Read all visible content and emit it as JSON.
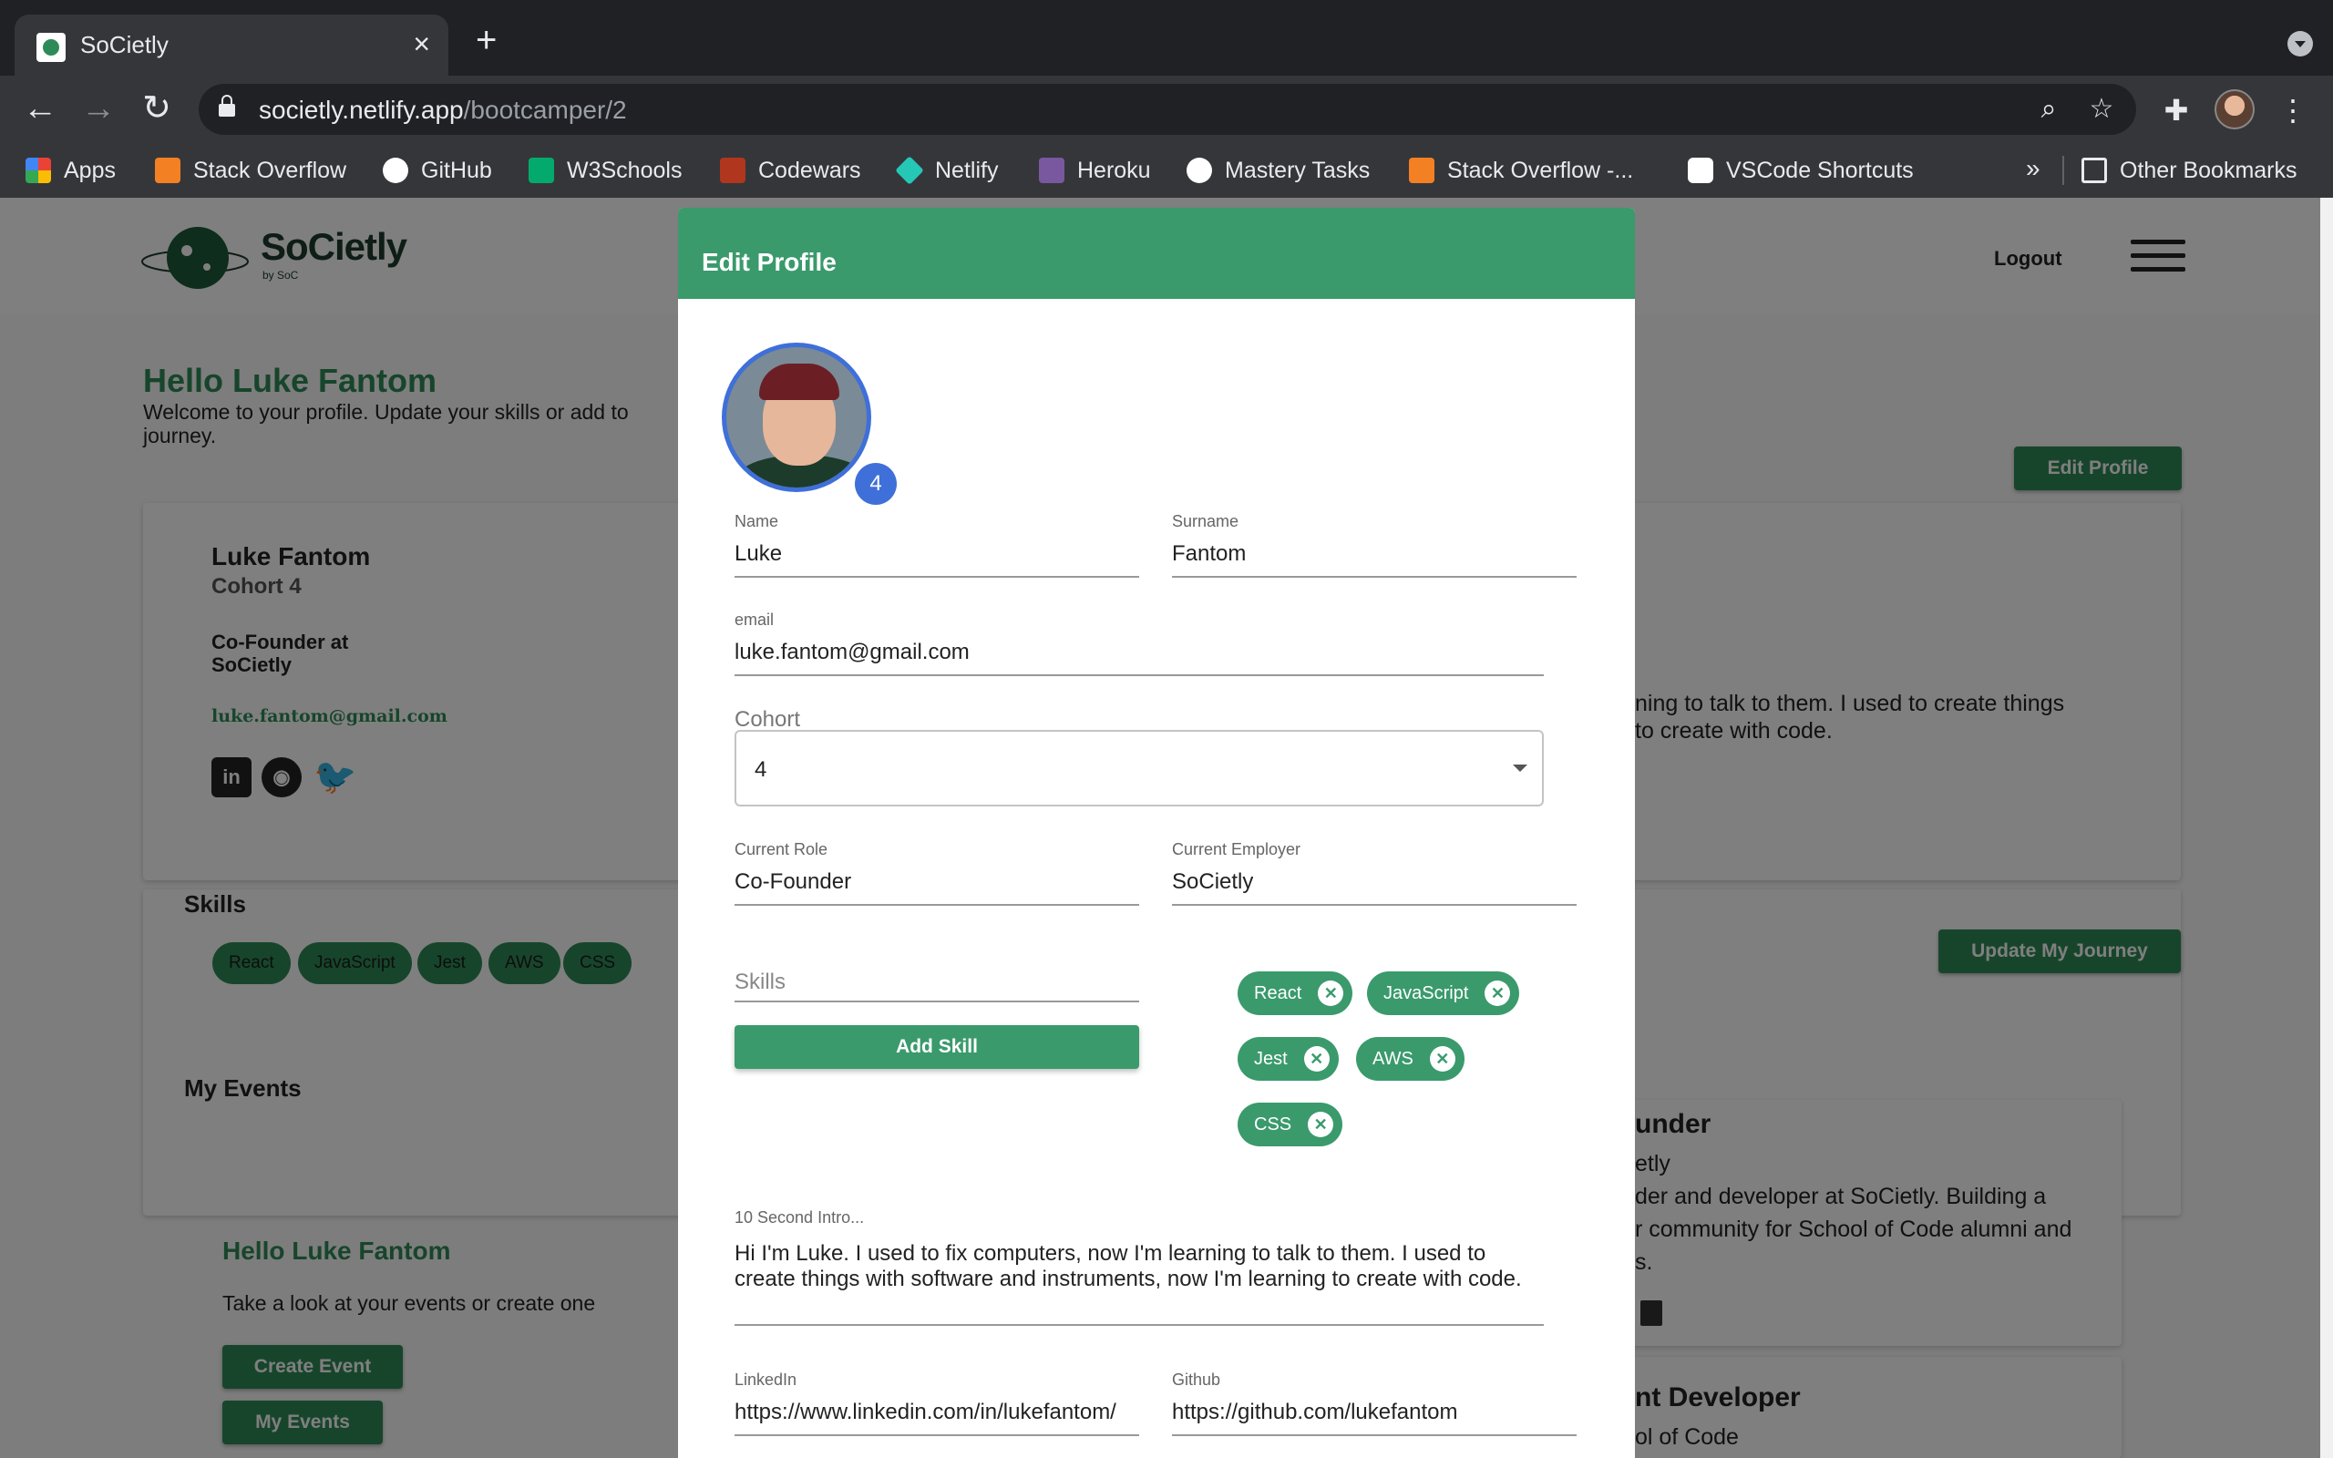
{
  "browser": {
    "tab_title": "SoCietly",
    "url_host": "societly.netlify.app",
    "url_path": "/bootcamper/2",
    "bookmarks": [
      {
        "label": "Apps",
        "color": "#ea4335"
      },
      {
        "label": "Stack Overflow",
        "color": "#f48024"
      },
      {
        "label": "GitHub",
        "color": "#ffffff"
      },
      {
        "label": "W3Schools",
        "color": "#04aa6d"
      },
      {
        "label": "Codewars",
        "color": "#b1361e"
      },
      {
        "label": "Netlify",
        "color": "#25c7b7"
      },
      {
        "label": "Heroku",
        "color": "#79589f"
      },
      {
        "label": "Mastery Tasks",
        "color": "#ffffff"
      },
      {
        "label": "Stack Overflow -...",
        "color": "#f48024"
      },
      {
        "label": "VSCode Shortcuts",
        "color": "#ffffff"
      }
    ],
    "more_bookmarks": "»",
    "other_bookmarks": "Other Bookmarks"
  },
  "page": {
    "logo_text": "SoCietly",
    "logo_sub": "by SoC",
    "logout": "Logout",
    "hello_title": "Hello Luke Fantom",
    "hello_sub": "Welcome to your profile. Update your skills or add to journey.",
    "edit_profile_button": "Edit Profile",
    "profile_name": "Luke Fantom",
    "profile_cohort": "Cohort 4",
    "profile_role": "Co-Founder at SoCietly",
    "profile_email": "luke.fantom@gmail.com",
    "skills_title": "Skills",
    "skills": [
      "React",
      "JavaScript",
      "Jest",
      "AWS",
      "CSS"
    ],
    "my_events_title": "My Events",
    "events_hello": "Hello Luke Fantom",
    "events_sub": "Take a look at your events or create one",
    "create_event": "Create Event",
    "my_events_button": "My Events",
    "update_journey": "Update My Journey",
    "intro_fragment_1": "ning to talk to them. I used to create things",
    "intro_fragment_2": "to create with code.",
    "journey_1_title": "under",
    "journey_1_company": "etly",
    "journey_1_desc_1": "der and developer at SoCietly. Building a",
    "journey_1_desc_2": "r community for School of Code alumni and",
    "journey_1_desc_3": "s.",
    "journey_2_title": "nt Developer",
    "journey_2_company": "ol of Code"
  },
  "modal": {
    "title": "Edit Profile",
    "avatar_badge": "4",
    "name_label": "Name",
    "name_value": "Luke",
    "surname_label": "Surname",
    "surname_value": "Fantom",
    "email_label": "email",
    "email_value": "luke.fantom@gmail.com",
    "cohort_label": "Cohort",
    "cohort_value": "4",
    "role_label": "Current Role",
    "role_value": "Co-Founder",
    "employer_label": "Current Employer",
    "employer_value": "SoCietly",
    "skills_placeholder": "Skills",
    "add_skill_button": "Add Skill",
    "skill_chips": [
      "React",
      "JavaScript",
      "Jest",
      "AWS",
      "CSS"
    ],
    "intro_label": "10 Second Intro...",
    "intro_value": "Hi I'm Luke. I used to fix computers, now I'm learning to talk to them. I used to create things with software and instruments, now I'm learning to create with code.",
    "linkedin_label": "LinkedIn",
    "linkedin_value": "https://www.linkedin.com/in/lukefantom/",
    "github_label": "Github",
    "github_value": "https://github.com/lukefantom"
  },
  "colors": {
    "brand_green": "#3a9a6c",
    "badge_blue": "#3f6fd8"
  }
}
